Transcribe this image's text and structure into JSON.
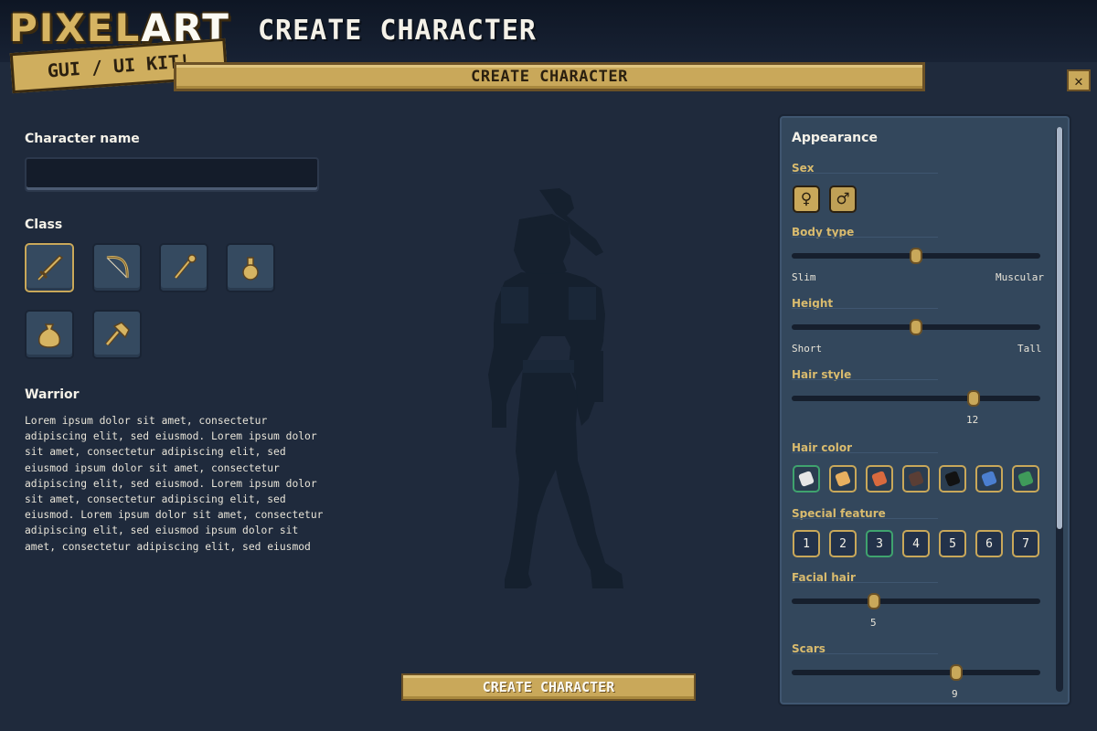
{
  "logo": {
    "line1_a": "PIXEL",
    "line1_b": "ART",
    "line2": "GUI / UI KIT!"
  },
  "header": {
    "title": "CREATE CHARACTER",
    "banner": "CREATE CHARACTER",
    "close_icon": "close-icon"
  },
  "left": {
    "name_label": "Character name",
    "name_value": "",
    "class_label": "Class",
    "classes": [
      {
        "icon": "sword-icon",
        "selected": true
      },
      {
        "icon": "bow-icon",
        "selected": false
      },
      {
        "icon": "staff-icon",
        "selected": false
      },
      {
        "icon": "potion-icon",
        "selected": false
      },
      {
        "icon": "money-bag-icon",
        "selected": false
      },
      {
        "icon": "hammer-icon",
        "selected": false
      }
    ],
    "class_name": "Warrior",
    "class_description": "Lorem ipsum dolor sit amet, consectetur adipiscing elit, sed eiusmod. Lorem ipsum dolor sit amet, consectetur adipiscing elit, sed eiusmod ipsum dolor sit amet, consectetur adipiscing elit, sed eiusmod. Lorem ipsum dolor sit amet, consectetur adipiscing elit, sed eiusmod. Lorem ipsum dolor sit amet, consectetur adipiscing elit, sed eiusmod ipsum dolor sit amet, consectetur adipiscing elit, sed eiusmod"
  },
  "create_button": "CREATE CHARACTER",
  "appearance": {
    "title": "Appearance",
    "sex_label": "Sex",
    "sex_female": "♀",
    "sex_male": "♂",
    "body_type": {
      "label": "Body type",
      "min": "Slim",
      "max": "Muscular",
      "value": 0.5
    },
    "height": {
      "label": "Height",
      "min": "Short",
      "max": "Tall",
      "value": 0.5
    },
    "hair_style": {
      "label": "Hair style",
      "value": 12,
      "position": 0.73
    },
    "hair_color": {
      "label": "Hair color",
      "colors": [
        "#e6e6e6",
        "#e8b060",
        "#d96a3e",
        "#5a3e35",
        "#121212",
        "#4b7fd0",
        "#3f9a5a"
      ],
      "selected_index": 0
    },
    "special_feature": {
      "label": "Special feature",
      "options": [
        "1",
        "2",
        "3",
        "4",
        "5",
        "6",
        "7"
      ],
      "selected_index": 2
    },
    "facial_hair": {
      "label": "Facial hair",
      "value": 5,
      "position": 0.33
    },
    "scars": {
      "label": "Scars",
      "value": 9,
      "position": 0.66
    }
  },
  "colors": {
    "accent": "#c9a85a",
    "selected": "#3fa36e",
    "background": "#1f2a3c",
    "panel": "#33475c"
  }
}
